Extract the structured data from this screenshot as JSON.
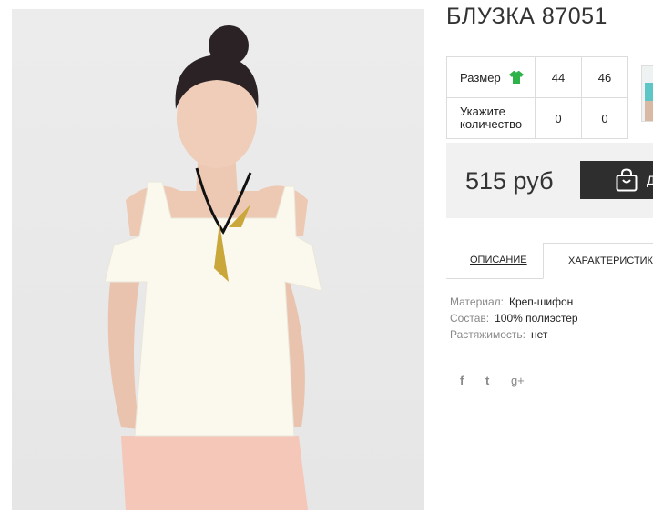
{
  "product": {
    "title": "БЛУЗКА 87051",
    "price": "515 руб",
    "buy_label": "Д"
  },
  "size_table": {
    "size_label": "Размер",
    "qty_label_line1": "Укажите",
    "qty_label_line2": "количество",
    "sizes": [
      "44",
      "46"
    ],
    "quantities": [
      "0",
      "0"
    ]
  },
  "tabs": {
    "description": "ОПИСАНИЕ",
    "characteristics": "ХАРАКТЕРИСТИКИ"
  },
  "specs": [
    {
      "key": "Материал:",
      "value": "Креп-шифон"
    },
    {
      "key": "Состав:",
      "value": "100% полиэстер"
    },
    {
      "key": "Растяжимость:",
      "value": "нет"
    }
  ],
  "social": {
    "facebook": "f",
    "twitter": "t",
    "gplus": "g+"
  },
  "icons": {
    "size_icon": "tshirt-icon",
    "bag_icon": "shopping-bag-icon"
  },
  "colors": {
    "accent_green": "#2fb24a",
    "button_dark": "#2e2e2e",
    "price_bg": "#f1f1f1"
  }
}
